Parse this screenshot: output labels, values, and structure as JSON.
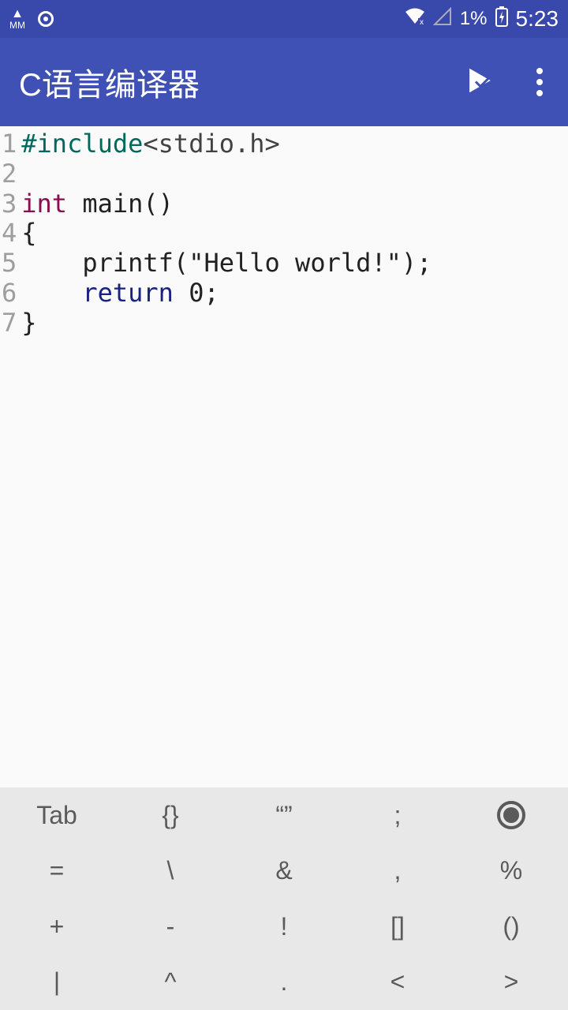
{
  "status_bar": {
    "mm_label_top": "▲",
    "mm_label_bottom": "MM",
    "battery_pct": "1%",
    "time": "5:23"
  },
  "app_bar": {
    "title": "C语言编译器"
  },
  "editor": {
    "lines": [
      {
        "n": "1",
        "tokens": [
          {
            "t": "#include",
            "cls": "tok-preproc"
          },
          {
            "t": "<stdio.h>",
            "cls": "tok-header"
          }
        ]
      },
      {
        "n": "2",
        "tokens": []
      },
      {
        "n": "3",
        "tokens": [
          {
            "t": "int",
            "cls": "tok-keyword"
          },
          {
            "t": " main()",
            "cls": ""
          }
        ]
      },
      {
        "n": "4",
        "tokens": [
          {
            "t": "{",
            "cls": ""
          }
        ]
      },
      {
        "n": "5",
        "tokens": [
          {
            "t": "    printf(\"Hello world!\");",
            "cls": ""
          }
        ]
      },
      {
        "n": "6",
        "tokens": [
          {
            "t": "    ",
            "cls": ""
          },
          {
            "t": "return",
            "cls": "tok-return"
          },
          {
            "t": " 0;",
            "cls": ""
          }
        ]
      },
      {
        "n": "7",
        "tokens": [
          {
            "t": "}",
            "cls": ""
          }
        ]
      }
    ]
  },
  "keys": {
    "r0c0": "Tab",
    "r0c1": "{}",
    "r0c2": "“”",
    "r0c3": ";",
    "r0c4": "◉",
    "r1c0": "=",
    "r1c1": "\\",
    "r1c2": "&",
    "r1c3": ",",
    "r1c4": "%",
    "r2c0": "+",
    "r2c1": "-",
    "r2c2": "!",
    "r2c3": "[]",
    "r2c4": "()",
    "r3c0": "|",
    "r3c1": "^",
    "r3c2": ".",
    "r3c3": "<",
    "r3c4": ">"
  }
}
